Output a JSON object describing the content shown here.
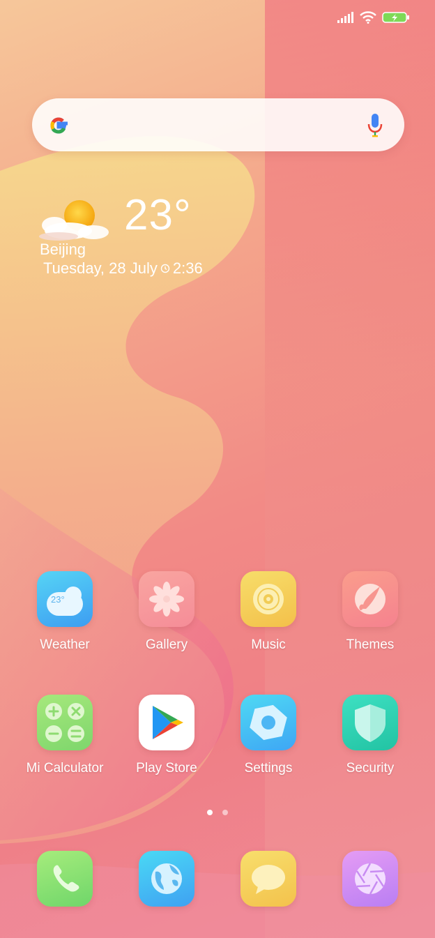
{
  "status_bar": {
    "signal_icon": "signal-bars-icon",
    "wifi_icon": "wifi-icon",
    "battery_icon": "battery-charging-icon"
  },
  "search": {
    "logo_icon": "google-g-icon",
    "mic_icon": "microphone-icon"
  },
  "weather_widget": {
    "icon": "sun-cloud-icon",
    "temperature": "23°",
    "city": "Beijing",
    "date": "Tuesday, 28 July",
    "clock_icon": "clock-icon",
    "time": "2:36"
  },
  "apps": [
    {
      "label": "Weather",
      "icon": "weather-app-icon"
    },
    {
      "label": "Gallery",
      "icon": "gallery-app-icon"
    },
    {
      "label": "Music",
      "icon": "music-app-icon"
    },
    {
      "label": "Themes",
      "icon": "themes-app-icon"
    },
    {
      "label": "Mi Calculator",
      "icon": "calculator-app-icon"
    },
    {
      "label": "Play Store",
      "icon": "play-store-app-icon"
    },
    {
      "label": "Settings",
      "icon": "settings-app-icon"
    },
    {
      "label": "Security",
      "icon": "security-app-icon"
    }
  ],
  "weather_app_badge": "23°",
  "page_indicator": {
    "pages": 2,
    "current": 1
  },
  "dock": [
    {
      "icon": "phone-app-icon"
    },
    {
      "icon": "browser-app-icon"
    },
    {
      "icon": "messages-app-icon"
    },
    {
      "icon": "camera-app-icon"
    }
  ],
  "colors": {
    "accent_pink": "#ef6f86",
    "wave_yellow": "#f6d68a",
    "wave_pink": "#ee5f8c"
  }
}
